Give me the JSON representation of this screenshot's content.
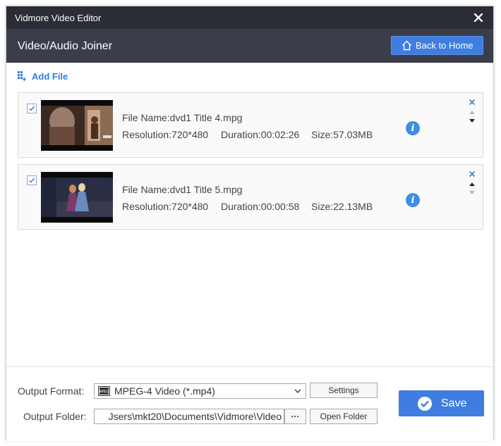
{
  "window": {
    "title": "Vidmore Video Editor"
  },
  "header": {
    "title": "Video/Audio Joiner",
    "back_label": "Back to Home"
  },
  "add_file_label": "Add File",
  "files": [
    {
      "name_label": "File Name:dvd1 Title 4.mpg",
      "resolution": "Resolution:720*480",
      "duration": "Duration:00:02:26",
      "size": "Size:57.03MB",
      "checked": true
    },
    {
      "name_label": "File Name:dvd1 Title 5.mpg",
      "resolution": "Resolution:720*480",
      "duration": "Duration:00:00:58",
      "size": "Size:22.13MB",
      "checked": true
    }
  ],
  "footer": {
    "output_format_label": "Output Format:",
    "output_format_value": "MPEG-4 Video (*.mp4)",
    "settings_label": "Settings",
    "output_folder_label": "Output Folder:",
    "output_folder_value": "Jsers\\mkt20\\Documents\\Vidmore\\Video",
    "browse_label": "···",
    "open_folder_label": "Open Folder",
    "save_label": "Save"
  },
  "colors": {
    "accent": "#3f7ee0",
    "titlebar": "#2b2d35",
    "header": "#3b3e4a",
    "link": "#2f7ee6"
  }
}
